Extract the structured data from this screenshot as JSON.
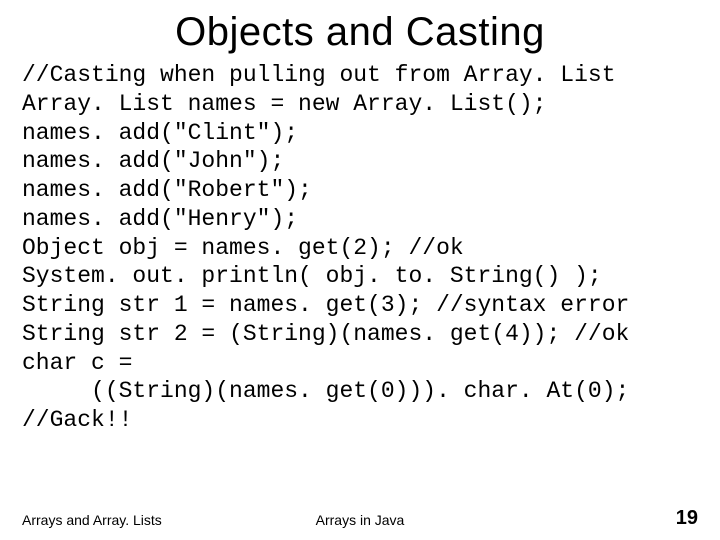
{
  "title": "Objects and Casting",
  "code": "//Casting when pulling out from Array. List\nArray. List names = new Array. List();\nnames. add(\"Clint\");\nnames. add(\"John\");\nnames. add(\"Robert\");\nnames. add(\"Henry\");\nObject obj = names. get(2); //ok\nSystem. out. println( obj. to. String() );\nString str 1 = names. get(3); //syntax error\nString str 2 = (String)(names. get(4)); //ok\nchar c =\n     ((String)(names. get(0))). char. At(0);\n//Gack!!",
  "footer": {
    "left": "Arrays and Array. Lists",
    "center": "Arrays in Java",
    "page": "19"
  }
}
